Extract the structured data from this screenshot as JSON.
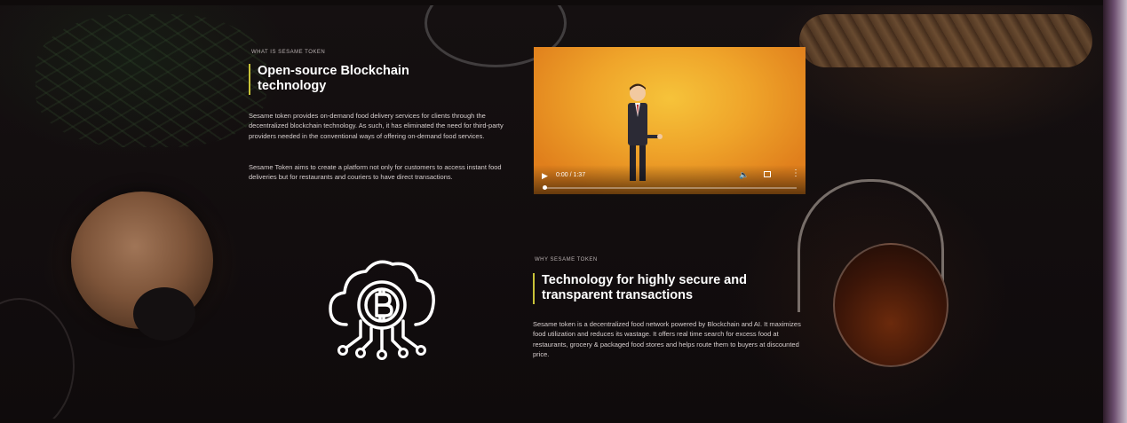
{
  "section1": {
    "eyebrow": "WHAT IS SESAME TOKEN",
    "title_line1": "Open-source Blockchain",
    "title_line2": "technology",
    "paragraph1": "Sesame token provides on-demand food delivery services for clients through the decentralized blockchain technology. As such, it has eliminated the need for third-party providers needed in the conventional ways of offering on-demand food services.",
    "paragraph2": "Sesame Token aims to create a platform not only for customers to access instant food deliveries but for restaurants and couriers to have direct transactions."
  },
  "video": {
    "time": "0:00 / 1:37",
    "progress": 0
  },
  "section2": {
    "eyebrow": "WHY SESAME TOKEN",
    "title_line1": "Technology for highly secure and",
    "title_line2": "transparent transactions",
    "paragraph": "Sesame token is a decentralized food network powered by Blockchain and AI. It maximizes food utilization and reduces its wastage. It offers real time search for excess food at restaurants, grocery & packaged food stores and helps route them to buyers at discounted price."
  },
  "icons": {
    "bitcoin_cloud": "bitcoin-cloud-network-icon",
    "play": "play-icon",
    "volume": "volume-icon",
    "fullscreen": "fullscreen-icon",
    "more": "more-vertical-icon"
  },
  "colors": {
    "accent": "#c8c238",
    "heading": "#ffffff",
    "background": "#120d0e"
  }
}
